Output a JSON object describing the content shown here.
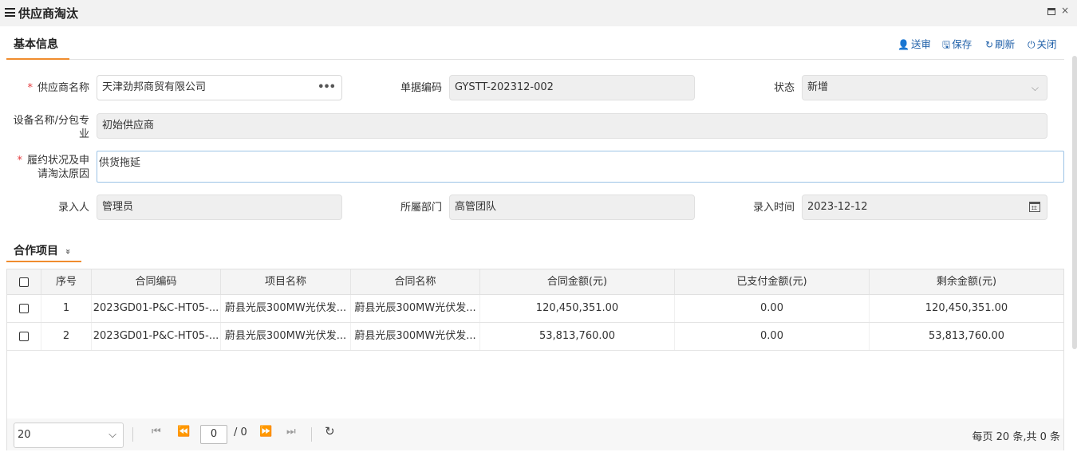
{
  "window": {
    "title": "供应商淘汰",
    "maximize_icon": "maximize-icon",
    "close_glyph": "×"
  },
  "tabs": {
    "basic_info": "基本信息",
    "projects": "合作项目",
    "projects_toggle_glyph": "»"
  },
  "toolbar": {
    "submit": "送审",
    "save": "保存",
    "refresh": "刷新",
    "close": "关闭"
  },
  "form": {
    "supplier_name_label": "供应商名称",
    "supplier_name_value": "天津劲邦商贸有限公司",
    "doc_code_label": "单据编码",
    "doc_code_value": "GYSTT-202312-002",
    "status_label": "状态",
    "status_value": "新增",
    "equipment_label_1": "设备名称/分包专",
    "equipment_label_2": "业",
    "equipment_value": "初始供应商",
    "reason_label_1": "履约状况及申",
    "reason_label_2": "请淘汰原因",
    "reason_value": "供货拖延",
    "entered_by_label": "录入人",
    "entered_by_value": "管理员",
    "department_label": "所屬部门",
    "department_value": "高管团队",
    "entry_time_label": "录入时间",
    "entry_time_value": "2023-12-12",
    "required_mark": "*"
  },
  "table": {
    "columns": [
      "序号",
      "合同编码",
      "项目名称",
      "合同名称",
      "合同金额(元)",
      "已支付金额(元)",
      "剩余金额(元)"
    ],
    "rows": [
      {
        "seq": "1",
        "contract_code": "2023GD01-P&C-HT05-...",
        "project_name": "蔚县光辰300MW光伏发...",
        "contract_name": "蔚县光辰300MW光伏发...",
        "amount": "120,450,351.00",
        "paid": "0.00",
        "remaining": "120,450,351.00"
      },
      {
        "seq": "2",
        "contract_code": "2023GD01-P&C-HT05-...",
        "project_name": "蔚县光辰300MW光伏发...",
        "contract_name": "蔚县光辰300MW光伏发...",
        "amount": "53,813,760.00",
        "paid": "0.00",
        "remaining": "53,813,760.00"
      }
    ]
  },
  "pager": {
    "page_size": "20",
    "current_page": "0",
    "total_pages": "/ 0",
    "info": "每页 20 条,共 0 条"
  }
}
